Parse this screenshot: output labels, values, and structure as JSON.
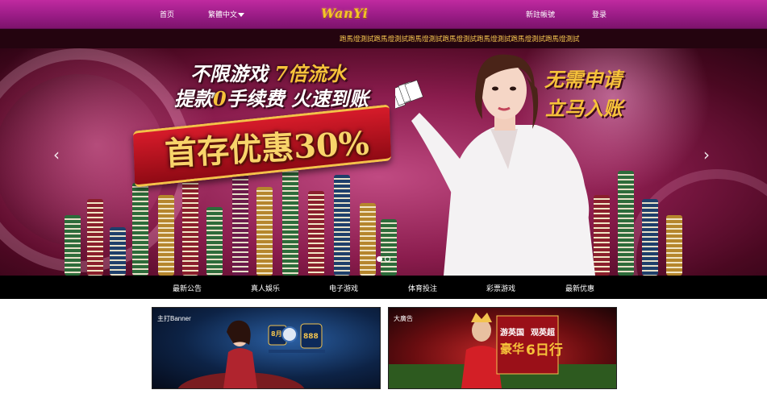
{
  "nav": {
    "home": "首页",
    "language": "繁體中文",
    "logo": "WanYi",
    "register": "新註帳號",
    "login": "登录"
  },
  "ticker": {
    "text": "跑馬燈測試跑馬燈測試跑馬燈測試跑馬燈測試跑馬燈測試跑馬燈測試跑馬燈測試"
  },
  "hero": {
    "line1_white_a": "不限游戏 ",
    "line1_gold": "7倍",
    "line1_white_b": "流水",
    "line2_white_a": "提款",
    "line2_gold": "0",
    "line2_white_b": "手续费  火速到账",
    "ribbon": "首存优惠30%",
    "right_line1": "无需申请",
    "right_line2": "立马入账",
    "prev_glyph": "‹",
    "next_glyph": "›",
    "slide_count": 2,
    "active_slide": 1
  },
  "categories": [
    "最新公告",
    "真人娛乐",
    "电子游戏",
    "体育投注",
    "彩票游戏",
    "最新优惠"
  ],
  "cards": {
    "left_label": "主打Banner",
    "left_badge_a": "8月",
    "left_badge_b": "888",
    "right_label": "大廣告",
    "right_text_a": "游英国",
    "right_text_b": "观英超",
    "right_text_c": "豪华",
    "right_text_d": "6日行"
  },
  "colors": {
    "nav_magenta": "#9a1c86",
    "ticker_bg": "#24040f",
    "ticker_text": "#f2c34f",
    "gold": "#f6c23a",
    "catbar_bg": "#000000"
  }
}
